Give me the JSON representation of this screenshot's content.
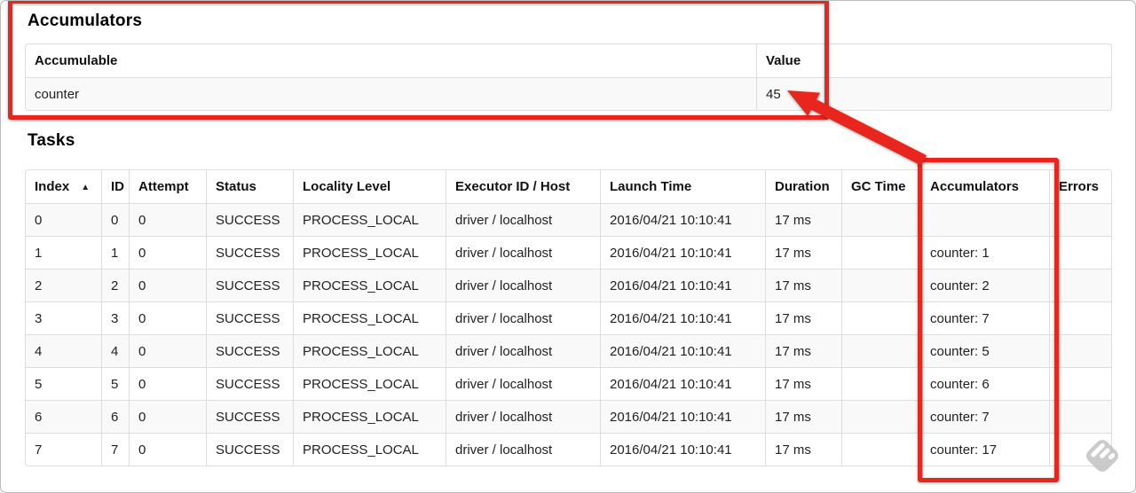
{
  "accumulators_section": {
    "title": "Accumulators",
    "columns": [
      "Accumulable",
      "Value"
    ],
    "rows": [
      [
        "counter",
        "45"
      ]
    ]
  },
  "tasks_section": {
    "title": "Tasks",
    "columns": [
      "Index",
      "ID",
      "Attempt",
      "Status",
      "Locality Level",
      "Executor ID / Host",
      "Launch Time",
      "Duration",
      "GC Time",
      "Accumulators",
      "Errors"
    ],
    "sort": {
      "column": "Index",
      "indicator": "▲"
    },
    "rows": [
      [
        "0",
        "0",
        "0",
        "SUCCESS",
        "PROCESS_LOCAL",
        "driver / localhost",
        "2016/04/21 10:10:41",
        "17 ms",
        "",
        "",
        ""
      ],
      [
        "1",
        "1",
        "0",
        "SUCCESS",
        "PROCESS_LOCAL",
        "driver / localhost",
        "2016/04/21 10:10:41",
        "17 ms",
        "",
        "counter: 1",
        ""
      ],
      [
        "2",
        "2",
        "0",
        "SUCCESS",
        "PROCESS_LOCAL",
        "driver / localhost",
        "2016/04/21 10:10:41",
        "17 ms",
        "",
        "counter: 2",
        ""
      ],
      [
        "3",
        "3",
        "0",
        "SUCCESS",
        "PROCESS_LOCAL",
        "driver / localhost",
        "2016/04/21 10:10:41",
        "17 ms",
        "",
        "counter: 7",
        ""
      ],
      [
        "4",
        "4",
        "0",
        "SUCCESS",
        "PROCESS_LOCAL",
        "driver / localhost",
        "2016/04/21 10:10:41",
        "17 ms",
        "",
        "counter: 5",
        ""
      ],
      [
        "5",
        "5",
        "0",
        "SUCCESS",
        "PROCESS_LOCAL",
        "driver / localhost",
        "2016/04/21 10:10:41",
        "17 ms",
        "",
        "counter: 6",
        ""
      ],
      [
        "6",
        "6",
        "0",
        "SUCCESS",
        "PROCESS_LOCAL",
        "driver / localhost",
        "2016/04/21 10:10:41",
        "17 ms",
        "",
        "counter: 7",
        ""
      ],
      [
        "7",
        "7",
        "0",
        "SUCCESS",
        "PROCESS_LOCAL",
        "driver / localhost",
        "2016/04/21 10:10:41",
        "17 ms",
        "",
        "counter: 17",
        ""
      ]
    ]
  },
  "annotations": {
    "accent_color": "#e8261d",
    "rects": [
      "accumulators-summary-highlight",
      "accumulators-column-highlight"
    ],
    "arrow": "accumulators-column-to-total-value-arrow"
  },
  "watermark": {
    "icon": "feedly-style-stamp-icon"
  }
}
